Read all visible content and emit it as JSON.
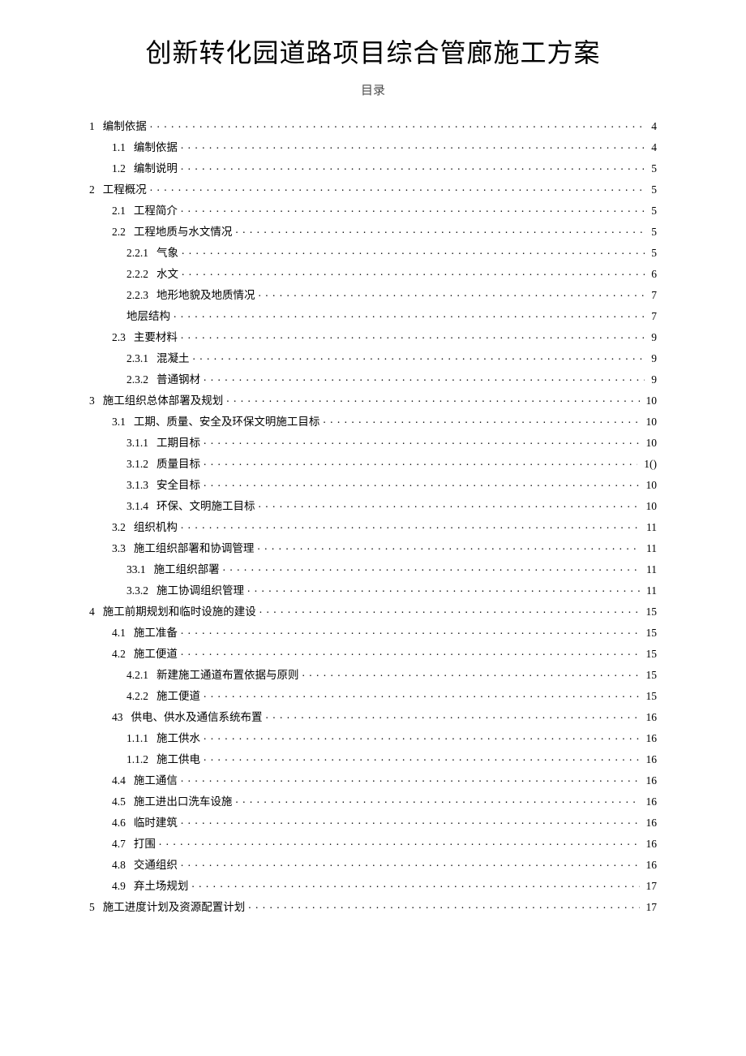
{
  "title": "创新转化园道路项目综合管廊施工方案",
  "subtitle": "目录",
  "toc": [
    {
      "level": 0,
      "num": "1",
      "label": "编制依据",
      "page": "4"
    },
    {
      "level": 1,
      "num": "1.1",
      "label": "编制依据",
      "page": "4"
    },
    {
      "level": 1,
      "num": "1.2",
      "label": "编制说明",
      "page": "5"
    },
    {
      "level": 0,
      "num": "2",
      "label": "工程概况",
      "page": "5"
    },
    {
      "level": 1,
      "num": "2.1",
      "label": "工程简介",
      "page": "5"
    },
    {
      "level": 1,
      "num": "2.2",
      "label": "工程地质与水文情况",
      "page": "5"
    },
    {
      "level": 2,
      "num": "2.2.1",
      "label": "气象",
      "page": "5"
    },
    {
      "level": 2,
      "num": "2.2.2",
      "label": "水文",
      "page": "6"
    },
    {
      "level": 2,
      "num": "2.2.3",
      "label": "地形地貌及地质情况",
      "page": "7"
    },
    {
      "level": 2,
      "num": "",
      "label": "地层结构",
      "page": "7"
    },
    {
      "level": 1,
      "num": "2.3",
      "label": "主要材料",
      "page": "9"
    },
    {
      "level": 2,
      "num": "2.3.1",
      "label": "混凝土",
      "page": "9"
    },
    {
      "level": 2,
      "num": "2.3.2",
      "label": "普通钢材",
      "page": "9"
    },
    {
      "level": 0,
      "num": "3",
      "label": "施工组织总体部署及规划",
      "page": "10"
    },
    {
      "level": 1,
      "num": "3.1",
      "label": "工期、质量、安全及环保文明施工目标",
      "page": "10"
    },
    {
      "level": 2,
      "num": "3.1.1",
      "label": "工期目标",
      "page": "10"
    },
    {
      "level": 2,
      "num": "3.1.2",
      "label": "质量目标",
      "page": "1()"
    },
    {
      "level": 2,
      "num": "3.1.3",
      "label": "安全目标",
      "page": "10"
    },
    {
      "level": 2,
      "num": "3.1.4",
      "label": "环保、文明施工目标",
      "page": "10"
    },
    {
      "level": 1,
      "num": "3.2",
      "label": "组织机构",
      "page": "11"
    },
    {
      "level": 1,
      "num": "3.3",
      "label": "施工组织部署和协调管理",
      "page": "11"
    },
    {
      "level": 2,
      "num": "33.1",
      "label": "施工组织部署",
      "page": "11"
    },
    {
      "level": 2,
      "num": "3.3.2",
      "label": "施工协调组织管理",
      "page": "11"
    },
    {
      "level": 0,
      "num": "4",
      "label": "施工前期规划和临时设施的建设",
      "page": "15"
    },
    {
      "level": 1,
      "num": "4.1",
      "label": "施工准备",
      "page": "15"
    },
    {
      "level": 1,
      "num": "4.2",
      "label": "施工便道",
      "page": "15"
    },
    {
      "level": 2,
      "num": "4.2.1",
      "label": "新建施工通道布置依据与原则",
      "page": "15"
    },
    {
      "level": 2,
      "num": "4.2.2",
      "label": "施工便道",
      "page": "15"
    },
    {
      "level": 1,
      "num": "43",
      "label": "供电、供水及通信系统布置",
      "page": "16"
    },
    {
      "level": 2,
      "num": "1.1.1",
      "label": "施工供水",
      "page": "16"
    },
    {
      "level": 2,
      "num": "1.1.2",
      "label": "施工供电",
      "page": "16"
    },
    {
      "level": 1,
      "num": "4.4",
      "label": "施工通信",
      "page": "16"
    },
    {
      "level": 1,
      "num": "4.5",
      "label": "施工进出口洗车设施",
      "page": "16"
    },
    {
      "level": 1,
      "num": "4.6",
      "label": "临时建筑",
      "page": "16"
    },
    {
      "level": 1,
      "num": "4.7",
      "label": "打围",
      "page": "16"
    },
    {
      "level": 1,
      "num": "4.8",
      "label": "交通组织",
      "page": "16"
    },
    {
      "level": 1,
      "num": "4.9",
      "label": "弃土场规划",
      "page": "17"
    },
    {
      "level": 0,
      "num": "5",
      "label": "施工进度计划及资源配置计划",
      "page": "17"
    }
  ]
}
